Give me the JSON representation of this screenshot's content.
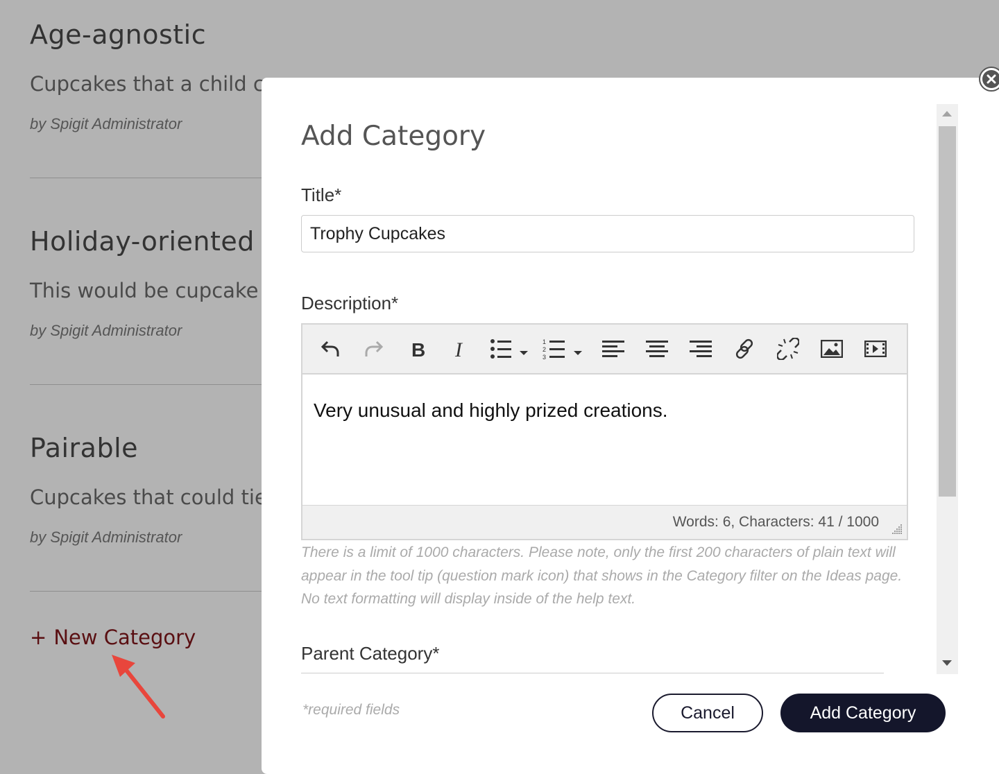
{
  "categories": [
    {
      "title": "Age-agnostic",
      "description": "Cupcakes that a child c",
      "author": "by Spigit Administrator"
    },
    {
      "title": "Holiday-oriented",
      "description": "This would be cupcake",
      "author": "by Spigit Administrator"
    },
    {
      "title": "Pairable",
      "description": "Cupcakes that could tie",
      "author": "by Spigit Administrator"
    }
  ],
  "new_category": {
    "plus": "+",
    "label": "New Category"
  },
  "modal": {
    "title": "Add Category",
    "title_label": "Title*",
    "title_value": "Trophy Cupcakes",
    "description_label": "Description*",
    "editor_text": "Very unusual and highly prized creations.",
    "editor_status": "Words: 6, Characters: 41 / 1000",
    "help_text": "There is a limit of 1000 characters. Please note, only the first 200 characters of plain text will appear in the tool tip (question mark icon) that shows in the Category filter on the Ideas page. No text formatting will display inside of the help text.",
    "parent_label": "Parent Category*",
    "required_note": "*required fields",
    "cancel_label": "Cancel",
    "add_label": "Add Category"
  },
  "toolbar_icons": [
    "undo-icon",
    "redo-icon",
    "bold-icon",
    "italic-icon",
    "bullet-list-icon",
    "numbered-list-icon",
    "align-left-icon",
    "align-center-icon",
    "align-right-icon",
    "link-icon",
    "unlink-icon",
    "image-icon",
    "video-icon"
  ],
  "colors": {
    "accent": "#14162b",
    "link": "#5a0f12",
    "overlay": "#b3b3b3",
    "arrow": "#e8463c"
  }
}
